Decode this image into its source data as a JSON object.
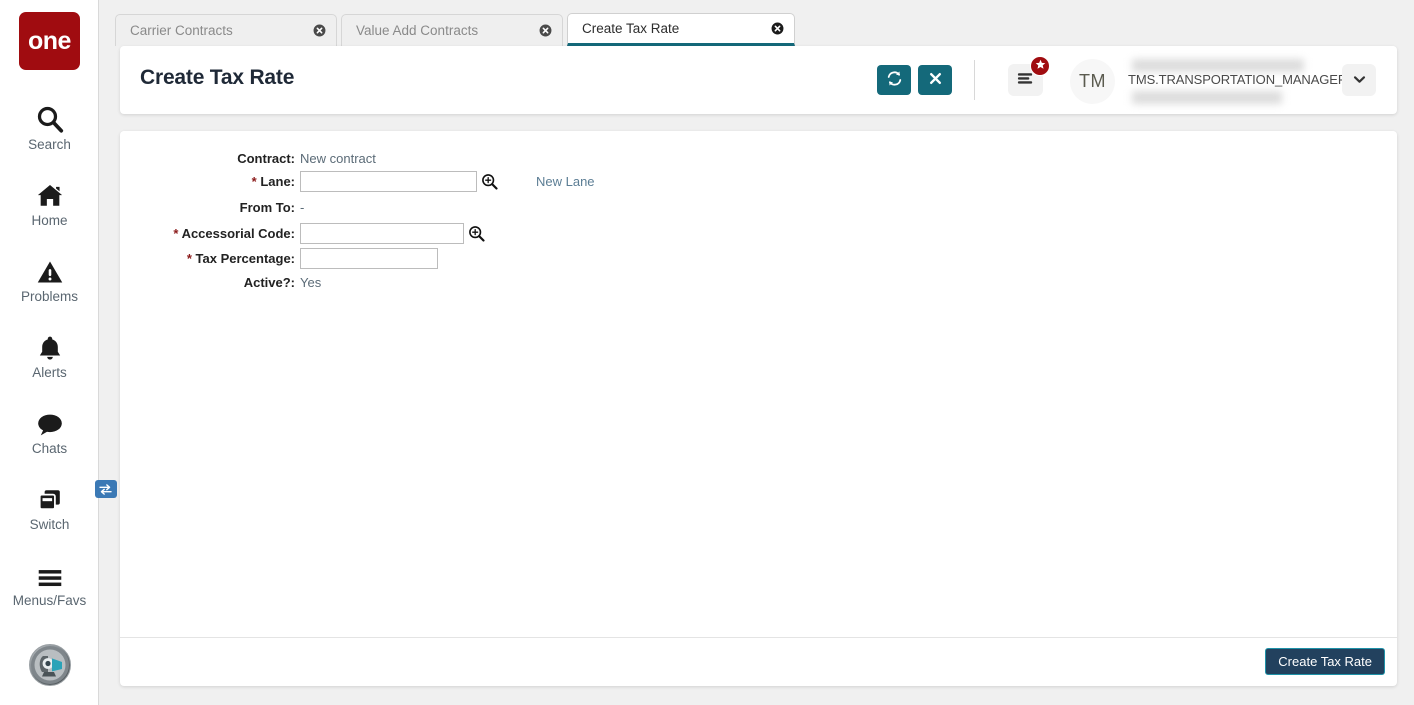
{
  "sidebar": {
    "logo_text": "one",
    "items": [
      {
        "label": "Search",
        "icon": "search-icon"
      },
      {
        "label": "Home",
        "icon": "home-icon"
      },
      {
        "label": "Problems",
        "icon": "warning-triangle-icon"
      },
      {
        "label": "Alerts",
        "icon": "bell-icon"
      },
      {
        "label": "Chats",
        "icon": "chat-bubble-icon"
      },
      {
        "label": "Switch",
        "icon": "switch-windows-icon",
        "badge_icon": "swap-arrows-icon"
      },
      {
        "label": "Menus/Favs",
        "icon": "hamburger-icon"
      }
    ],
    "bottom_avatar_icon": "robot-avatar-icon"
  },
  "tabs": [
    {
      "label": "Carrier Contracts",
      "active": false,
      "close_icon": "close-circle-icon"
    },
    {
      "label": "Value Add Contracts",
      "active": false,
      "close_icon": "close-circle-icon"
    },
    {
      "label": "Create Tax Rate",
      "active": true,
      "close_icon": "close-circle-icon"
    }
  ],
  "header": {
    "title": "Create Tax Rate",
    "refresh_icon": "refresh-icon",
    "close_icon": "x-icon",
    "menu_icon": "hamburger-menu-icon",
    "badge_icon": "star-icon",
    "avatar_initials": "TM",
    "user_name": "TMS.TRANSPORTATION_MANAGER",
    "caret_icon": "chevron-down-icon"
  },
  "form": {
    "rows": [
      {
        "label": "Contract:",
        "required": false,
        "type": "text",
        "value": "New contract"
      },
      {
        "label": "Lane:",
        "required": true,
        "type": "input",
        "value": "",
        "placeholder": "",
        "has_search": true,
        "link": "New Lane"
      },
      {
        "label": "From To:",
        "required": false,
        "type": "text",
        "value": "-"
      },
      {
        "label": "Accessorial Code:",
        "required": true,
        "type": "input",
        "value": "",
        "placeholder": "",
        "has_search": true
      },
      {
        "label": "Tax Percentage:",
        "required": true,
        "type": "input",
        "value": "",
        "placeholder": ""
      },
      {
        "label": "Active?:",
        "required": false,
        "type": "text",
        "value": "Yes"
      }
    ]
  },
  "footer": {
    "submit_label": "Create Tax Rate"
  },
  "colors": {
    "brand_red": "#a00c10",
    "teal": "#14697a",
    "submit_bg": "#22415e",
    "submit_border": "#1e92a8",
    "badge_blue": "#3b79b5",
    "required_star": "#8b1a1a"
  }
}
